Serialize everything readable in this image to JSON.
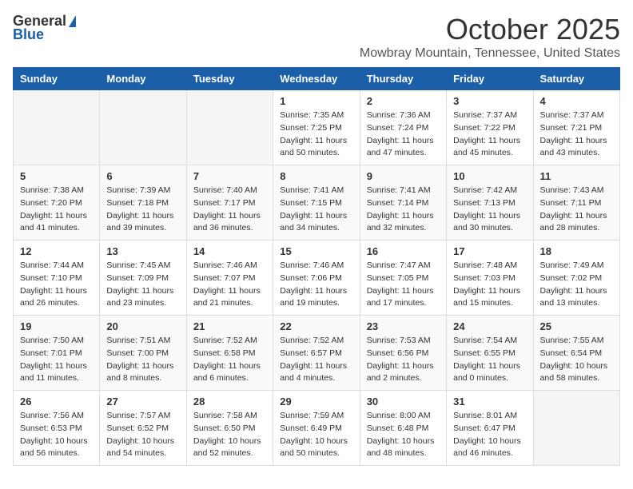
{
  "header": {
    "logo_general": "General",
    "logo_blue": "Blue",
    "month_title": "October 2025",
    "location": "Mowbray Mountain, Tennessee, United States"
  },
  "weekdays": [
    "Sunday",
    "Monday",
    "Tuesday",
    "Wednesday",
    "Thursday",
    "Friday",
    "Saturday"
  ],
  "weeks": [
    [
      {
        "day": "",
        "sunrise": "",
        "sunset": "",
        "daylight": ""
      },
      {
        "day": "",
        "sunrise": "",
        "sunset": "",
        "daylight": ""
      },
      {
        "day": "",
        "sunrise": "",
        "sunset": "",
        "daylight": ""
      },
      {
        "day": "1",
        "sunrise": "Sunrise: 7:35 AM",
        "sunset": "Sunset: 7:25 PM",
        "daylight": "Daylight: 11 hours and 50 minutes."
      },
      {
        "day": "2",
        "sunrise": "Sunrise: 7:36 AM",
        "sunset": "Sunset: 7:24 PM",
        "daylight": "Daylight: 11 hours and 47 minutes."
      },
      {
        "day": "3",
        "sunrise": "Sunrise: 7:37 AM",
        "sunset": "Sunset: 7:22 PM",
        "daylight": "Daylight: 11 hours and 45 minutes."
      },
      {
        "day": "4",
        "sunrise": "Sunrise: 7:37 AM",
        "sunset": "Sunset: 7:21 PM",
        "daylight": "Daylight: 11 hours and 43 minutes."
      }
    ],
    [
      {
        "day": "5",
        "sunrise": "Sunrise: 7:38 AM",
        "sunset": "Sunset: 7:20 PM",
        "daylight": "Daylight: 11 hours and 41 minutes."
      },
      {
        "day": "6",
        "sunrise": "Sunrise: 7:39 AM",
        "sunset": "Sunset: 7:18 PM",
        "daylight": "Daylight: 11 hours and 39 minutes."
      },
      {
        "day": "7",
        "sunrise": "Sunrise: 7:40 AM",
        "sunset": "Sunset: 7:17 PM",
        "daylight": "Daylight: 11 hours and 36 minutes."
      },
      {
        "day": "8",
        "sunrise": "Sunrise: 7:41 AM",
        "sunset": "Sunset: 7:15 PM",
        "daylight": "Daylight: 11 hours and 34 minutes."
      },
      {
        "day": "9",
        "sunrise": "Sunrise: 7:41 AM",
        "sunset": "Sunset: 7:14 PM",
        "daylight": "Daylight: 11 hours and 32 minutes."
      },
      {
        "day": "10",
        "sunrise": "Sunrise: 7:42 AM",
        "sunset": "Sunset: 7:13 PM",
        "daylight": "Daylight: 11 hours and 30 minutes."
      },
      {
        "day": "11",
        "sunrise": "Sunrise: 7:43 AM",
        "sunset": "Sunset: 7:11 PM",
        "daylight": "Daylight: 11 hours and 28 minutes."
      }
    ],
    [
      {
        "day": "12",
        "sunrise": "Sunrise: 7:44 AM",
        "sunset": "Sunset: 7:10 PM",
        "daylight": "Daylight: 11 hours and 26 minutes."
      },
      {
        "day": "13",
        "sunrise": "Sunrise: 7:45 AM",
        "sunset": "Sunset: 7:09 PM",
        "daylight": "Daylight: 11 hours and 23 minutes."
      },
      {
        "day": "14",
        "sunrise": "Sunrise: 7:46 AM",
        "sunset": "Sunset: 7:07 PM",
        "daylight": "Daylight: 11 hours and 21 minutes."
      },
      {
        "day": "15",
        "sunrise": "Sunrise: 7:46 AM",
        "sunset": "Sunset: 7:06 PM",
        "daylight": "Daylight: 11 hours and 19 minutes."
      },
      {
        "day": "16",
        "sunrise": "Sunrise: 7:47 AM",
        "sunset": "Sunset: 7:05 PM",
        "daylight": "Daylight: 11 hours and 17 minutes."
      },
      {
        "day": "17",
        "sunrise": "Sunrise: 7:48 AM",
        "sunset": "Sunset: 7:03 PM",
        "daylight": "Daylight: 11 hours and 15 minutes."
      },
      {
        "day": "18",
        "sunrise": "Sunrise: 7:49 AM",
        "sunset": "Sunset: 7:02 PM",
        "daylight": "Daylight: 11 hours and 13 minutes."
      }
    ],
    [
      {
        "day": "19",
        "sunrise": "Sunrise: 7:50 AM",
        "sunset": "Sunset: 7:01 PM",
        "daylight": "Daylight: 11 hours and 11 minutes."
      },
      {
        "day": "20",
        "sunrise": "Sunrise: 7:51 AM",
        "sunset": "Sunset: 7:00 PM",
        "daylight": "Daylight: 11 hours and 8 minutes."
      },
      {
        "day": "21",
        "sunrise": "Sunrise: 7:52 AM",
        "sunset": "Sunset: 6:58 PM",
        "daylight": "Daylight: 11 hours and 6 minutes."
      },
      {
        "day": "22",
        "sunrise": "Sunrise: 7:52 AM",
        "sunset": "Sunset: 6:57 PM",
        "daylight": "Daylight: 11 hours and 4 minutes."
      },
      {
        "day": "23",
        "sunrise": "Sunrise: 7:53 AM",
        "sunset": "Sunset: 6:56 PM",
        "daylight": "Daylight: 11 hours and 2 minutes."
      },
      {
        "day": "24",
        "sunrise": "Sunrise: 7:54 AM",
        "sunset": "Sunset: 6:55 PM",
        "daylight": "Daylight: 11 hours and 0 minutes."
      },
      {
        "day": "25",
        "sunrise": "Sunrise: 7:55 AM",
        "sunset": "Sunset: 6:54 PM",
        "daylight": "Daylight: 10 hours and 58 minutes."
      }
    ],
    [
      {
        "day": "26",
        "sunrise": "Sunrise: 7:56 AM",
        "sunset": "Sunset: 6:53 PM",
        "daylight": "Daylight: 10 hours and 56 minutes."
      },
      {
        "day": "27",
        "sunrise": "Sunrise: 7:57 AM",
        "sunset": "Sunset: 6:52 PM",
        "daylight": "Daylight: 10 hours and 54 minutes."
      },
      {
        "day": "28",
        "sunrise": "Sunrise: 7:58 AM",
        "sunset": "Sunset: 6:50 PM",
        "daylight": "Daylight: 10 hours and 52 minutes."
      },
      {
        "day": "29",
        "sunrise": "Sunrise: 7:59 AM",
        "sunset": "Sunset: 6:49 PM",
        "daylight": "Daylight: 10 hours and 50 minutes."
      },
      {
        "day": "30",
        "sunrise": "Sunrise: 8:00 AM",
        "sunset": "Sunset: 6:48 PM",
        "daylight": "Daylight: 10 hours and 48 minutes."
      },
      {
        "day": "31",
        "sunrise": "Sunrise: 8:01 AM",
        "sunset": "Sunset: 6:47 PM",
        "daylight": "Daylight: 10 hours and 46 minutes."
      },
      {
        "day": "",
        "sunrise": "",
        "sunset": "",
        "daylight": ""
      }
    ]
  ]
}
